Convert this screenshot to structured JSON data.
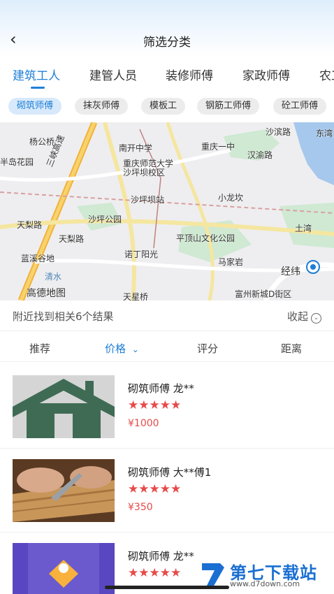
{
  "header": {
    "back_icon": "chevron-left-icon",
    "title": "筛选分类"
  },
  "category_tabs": [
    "建筑工人",
    "建管人员",
    "装修师傅",
    "家政师傅",
    "农工"
  ],
  "sub_tags": [
    "砌筑师傅",
    "抹灰师傅",
    "模板工",
    "钢筋工师傅",
    "砼工师傅"
  ],
  "map": {
    "labels": [
      "杨公桥",
      "半岛花园",
      "南开中学",
      "重庆一中",
      "汉渝路",
      "东湾",
      "沙滨路",
      "重庆师范大学",
      "沙坪坝校区",
      "沙坪坝站",
      "小龙坎",
      "三峡高速",
      "天梨路",
      "沙坪公园",
      "天梨路",
      "诺丁阳光",
      "平顶山文化公园",
      "土湾",
      "蓝溪谷地",
      "马家岩",
      "经纬",
      "富州新城D街区",
      "天星桥",
      "高德地图",
      "清水"
    ]
  },
  "results": {
    "summary": "附近找到相关6个结果",
    "collapse_label": "收起",
    "collapse_icon": "circle-chevron-down-icon"
  },
  "sort": {
    "items": [
      "推荐",
      "价格",
      "评分",
      "距离"
    ],
    "active": "价格",
    "arrow_icon": "chevron-down-icon"
  },
  "workers": [
    {
      "name": "砌筑师傅 龙**",
      "stars": "★★★★★",
      "price": "¥1000",
      "thumb_icon": "house-icon"
    },
    {
      "name": "砌筑师傅 大**傅1",
      "stars": "★★★★★",
      "price": "¥350",
      "thumb_icon": "woodwork-photo"
    },
    {
      "name": "砌筑师傅 龙**",
      "stars": "★★★★★",
      "price": "",
      "thumb_icon": "app-icon"
    }
  ],
  "watermark": {
    "title": "第七下载站",
    "url": "www.d7down.com"
  },
  "colors": {
    "accent": "#1f7fd6",
    "price": "#e64a4a",
    "tag_active_bg": "#d7e9fb"
  }
}
